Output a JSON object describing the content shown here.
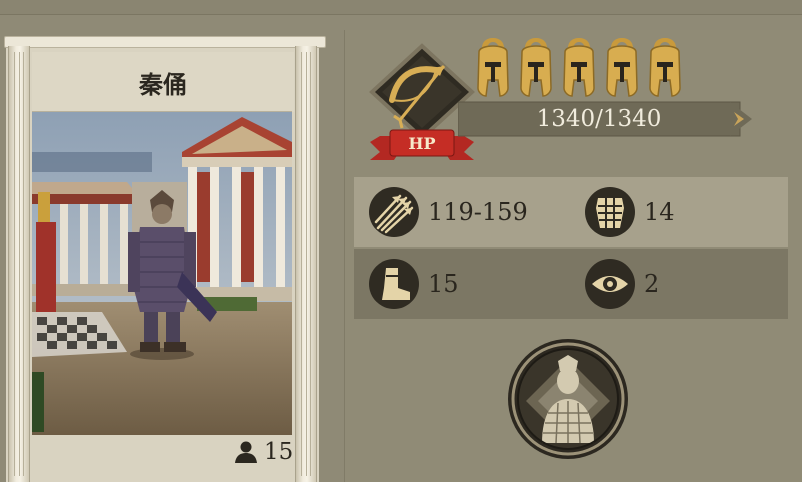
{
  "unit": {
    "name": "秦俑",
    "count": "15",
    "class_icon": "bow-icon",
    "class_badge": "HP"
  },
  "rank": {
    "icon": "spartan-helmet-icon",
    "stars": 5
  },
  "hp": {
    "text": "1340/1340",
    "current": 1340,
    "max": 1340
  },
  "stats": [
    {
      "icon": "arrow-volley-icon",
      "value": "119-159"
    },
    {
      "icon": "armor-icon",
      "value": "14"
    },
    {
      "icon": "boot-icon",
      "value": "15"
    },
    {
      "icon": "eye-icon",
      "value": "2"
    }
  ],
  "skill": {
    "icon": "terracotta-warrior-portrait"
  },
  "colors": {
    "background": "#8f8a76",
    "card": "#d9d3c1",
    "gold": "#d2a84a",
    "badge_red": "#b2261f",
    "hp_bar": "#6f6a57"
  }
}
